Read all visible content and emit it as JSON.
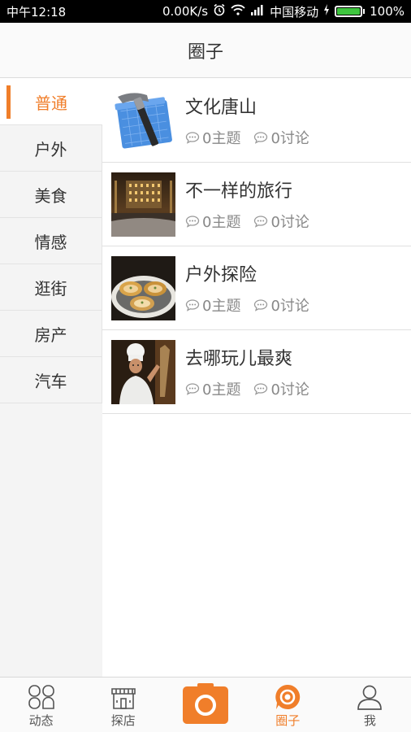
{
  "status_bar": {
    "time": "中午12:18",
    "speed": "0.00K/s",
    "carrier": "中国移动",
    "battery": "100%",
    "battery_level": 1.0
  },
  "header": {
    "title": "圈子"
  },
  "sidebar": {
    "items": [
      {
        "label": "普通",
        "active": true
      },
      {
        "label": "户外",
        "active": false
      },
      {
        "label": "美食",
        "active": false
      },
      {
        "label": "情感",
        "active": false
      },
      {
        "label": "逛街",
        "active": false
      },
      {
        "label": "房产",
        "active": false
      },
      {
        "label": "汽车",
        "active": false
      }
    ]
  },
  "circles": [
    {
      "name": "文化唐山",
      "topics": "0主题",
      "discussions": "0讨论",
      "thumb": "hammer-icon"
    },
    {
      "name": "不一样的旅行",
      "topics": "0主题",
      "discussions": "0讨论",
      "thumb": "city-night-photo"
    },
    {
      "name": "户外探险",
      "topics": "0主题",
      "discussions": "0讨论",
      "thumb": "oysters-photo"
    },
    {
      "name": "去哪玩儿最爽",
      "topics": "0主题",
      "discussions": "0讨论",
      "thumb": "chef-photo"
    }
  ],
  "tabbar": {
    "tabs": [
      {
        "label": "动态",
        "icon": "feed-icon"
      },
      {
        "label": "探店",
        "icon": "store-icon"
      },
      {
        "label": "",
        "icon": "camera-icon"
      },
      {
        "label": "圈子",
        "icon": "circle-icon",
        "active": true
      },
      {
        "label": "我",
        "icon": "person-icon"
      }
    ]
  },
  "colors": {
    "accent": "#f07e2a",
    "sidebar_bg": "#f4f4f4"
  }
}
